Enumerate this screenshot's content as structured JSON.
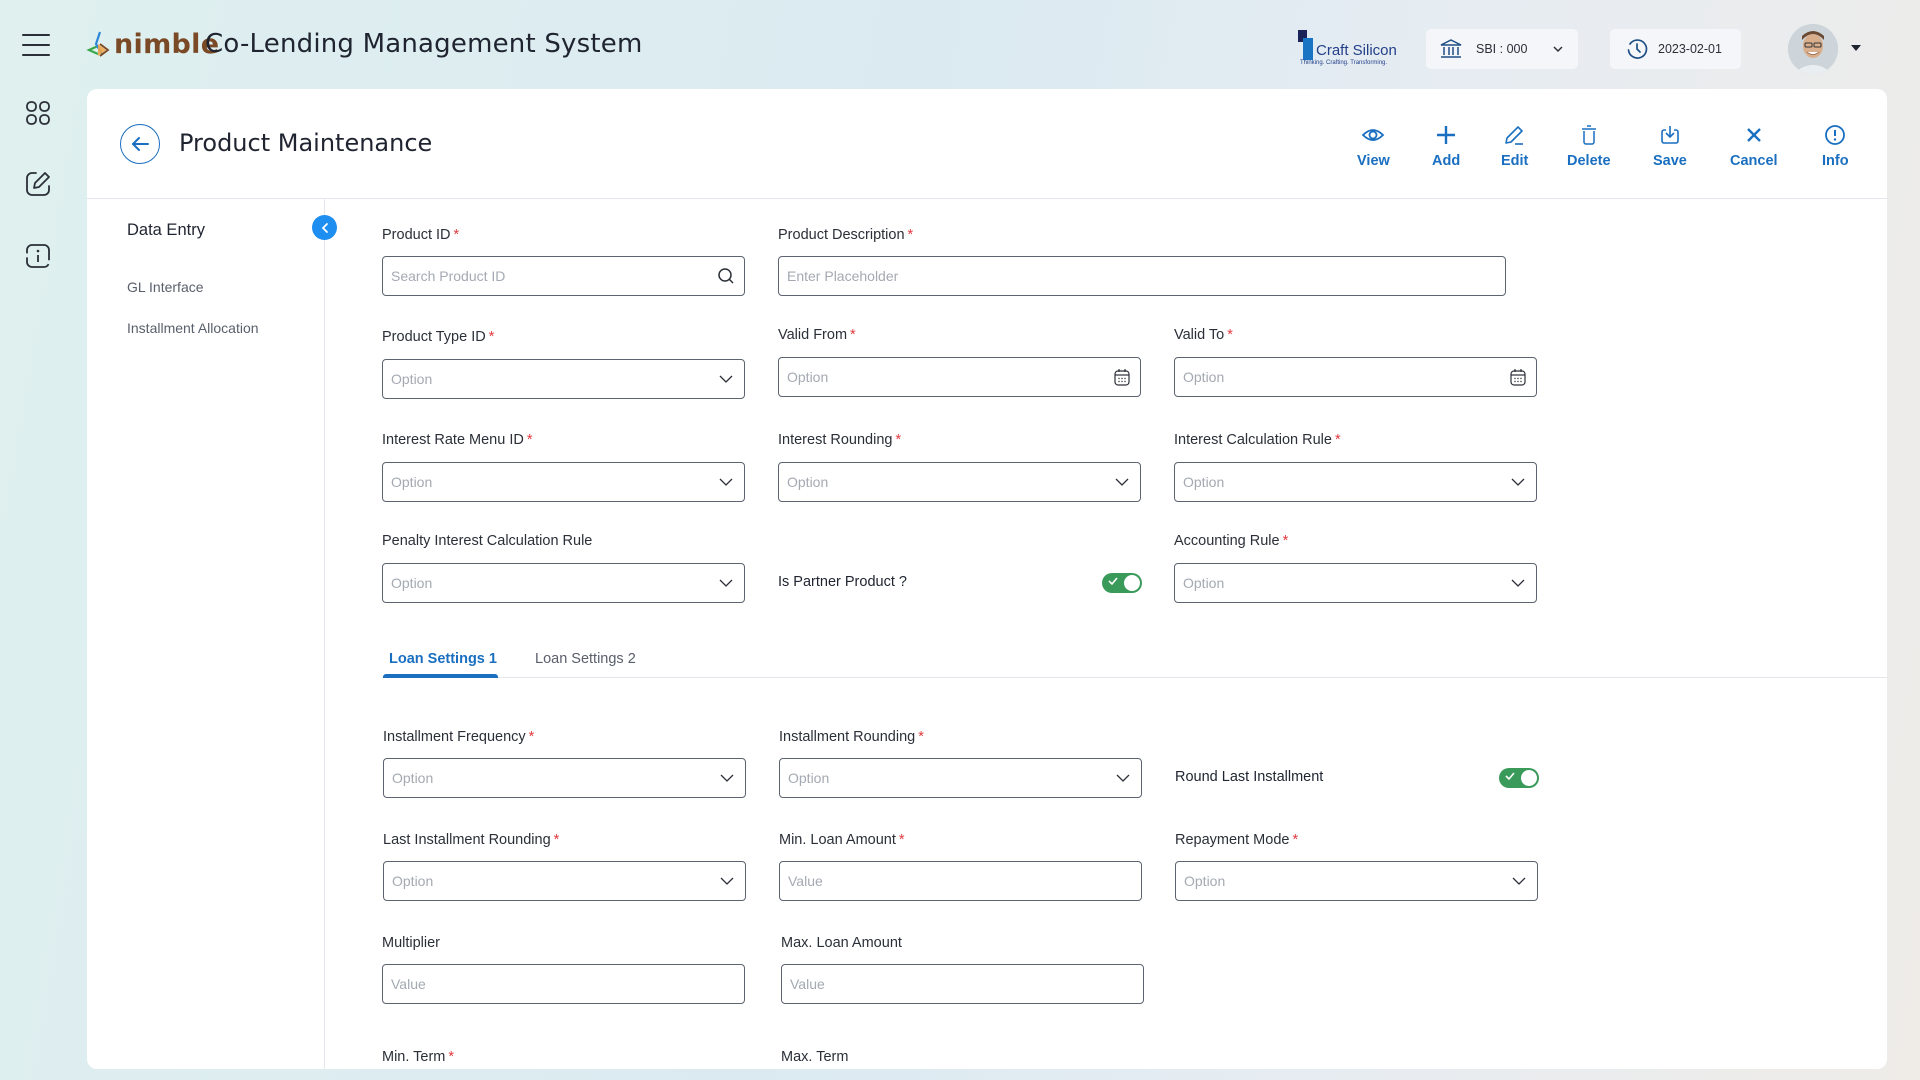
{
  "header": {
    "logo_text": "nimble",
    "app_title": "Co-Lending Management System",
    "partner_logo": {
      "name": "Craft Silicon",
      "tagline": "Thinking. Crafting. Transforming."
    },
    "branch_selector": {
      "icon": "bank-icon",
      "value": "SBI : 000"
    },
    "business_date": {
      "icon": "clock-icon",
      "value": "2023-02-01"
    },
    "user_menu": {
      "avatar": "user-avatar"
    }
  },
  "rail": {
    "items": [
      {
        "icon": "menu-icon"
      },
      {
        "icon": "dashboard-grid-icon"
      },
      {
        "icon": "edit-icon"
      },
      {
        "icon": "info-icon"
      }
    ]
  },
  "page": {
    "title": "Product Maintenance",
    "actions": [
      {
        "id": "view",
        "label": "View",
        "icon": "eye-icon"
      },
      {
        "id": "add",
        "label": "Add",
        "icon": "plus-icon"
      },
      {
        "id": "edit",
        "label": "Edit",
        "icon": "pencil-icon"
      },
      {
        "id": "delete",
        "label": "Delete",
        "icon": "trash-icon"
      },
      {
        "id": "save",
        "label": "Save",
        "icon": "save-icon"
      },
      {
        "id": "cancel",
        "label": "Cancel",
        "icon": "close-icon"
      },
      {
        "id": "info",
        "label": "Info",
        "icon": "info-circle-icon"
      }
    ]
  },
  "sidebar": {
    "title": "Data Entry",
    "items": [
      {
        "label": "GL Interface"
      },
      {
        "label": "Installment Allocation"
      }
    ]
  },
  "form": {
    "product_id": {
      "label": "Product ID",
      "required": "*",
      "placeholder": "Search Product ID"
    },
    "product_description": {
      "label": "Product Description",
      "required": "*",
      "placeholder": "Enter Placeholder"
    },
    "product_type_id": {
      "label": "Product Type ID",
      "required": "*",
      "placeholder": "Option"
    },
    "valid_from": {
      "label": "Valid From",
      "required": "*",
      "placeholder": "Option"
    },
    "valid_to": {
      "label": "Valid To",
      "required": "*",
      "placeholder": "Option"
    },
    "interest_rate_menu_id": {
      "label": "Interest Rate Menu ID",
      "required": "*",
      "placeholder": "Option"
    },
    "interest_rounding": {
      "label": "Interest Rounding",
      "required": "*",
      "placeholder": "Option"
    },
    "interest_calculation_rule": {
      "label": "Interest Calculation Rule",
      "required": "*",
      "placeholder": "Option"
    },
    "penalty_interest_calculation_rule": {
      "label": "Penalty Interest Calculation Rule",
      "placeholder": "Option"
    },
    "is_partner_product": {
      "label": "Is Partner Product ?",
      "checked": true
    },
    "accounting_rule": {
      "label": "Accounting Rule",
      "required": "*",
      "placeholder": "Option"
    }
  },
  "tabs": [
    {
      "label": "Loan Settings 1",
      "active": true
    },
    {
      "label": "Loan Settings 2",
      "active": false
    }
  ],
  "loan_settings_1": {
    "installment_frequency": {
      "label": "Installment Frequency",
      "required": "*",
      "placeholder": "Option"
    },
    "installment_rounding": {
      "label": "Installment Rounding",
      "required": "*",
      "placeholder": "Option"
    },
    "round_last_installment": {
      "label": "Round Last Installment",
      "checked": true
    },
    "last_installment_rounding": {
      "label": "Last Installment Rounding",
      "required": "*",
      "placeholder": "Option"
    },
    "min_loan_amount": {
      "label": "Min. Loan Amount",
      "required": "*",
      "placeholder": "Value"
    },
    "repayment_mode": {
      "label": "Repayment Mode",
      "required": "*",
      "placeholder": "Option"
    },
    "multiplier": {
      "label": "Multiplier",
      "placeholder": "Value"
    },
    "max_loan_amount": {
      "label": "Max. Loan Amount",
      "placeholder": "Value"
    },
    "min_term": {
      "label": "Min. Term",
      "required": "*"
    },
    "max_term": {
      "label": "Max. Term"
    }
  },
  "colors": {
    "accent": "#1a6fc0",
    "toggle_on": "#3a9a5a",
    "required": "#e0393e",
    "logo_brown": "#7a4a26"
  }
}
